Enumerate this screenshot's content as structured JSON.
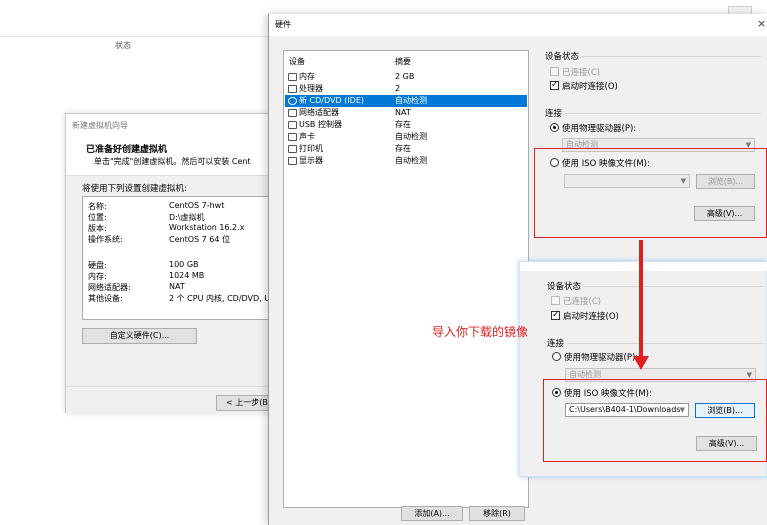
{
  "background": {
    "status_label": "状态"
  },
  "wizard": {
    "title": "新建虚拟机向导",
    "heading": "已准备好创建虚拟机",
    "subtext": "单击\"完成\"创建虚拟机。然后可以安装 Cent",
    "prompt": "将使用下列设置创建虚拟机:",
    "summary": [
      {
        "key": "名称:",
        "value": "CentOS 7-hwt"
      },
      {
        "key": "位置:",
        "value": "D:\\虚拟机"
      },
      {
        "key": "版本:",
        "value": "Workstation 16.2.x"
      },
      {
        "key": "操作系统:",
        "value": "CentOS 7 64 位"
      },
      {
        "key": "硬盘:",
        "value": "100 GB"
      },
      {
        "key": "内存:",
        "value": "1024 MB"
      },
      {
        "key": "网络适配器:",
        "value": "NAT"
      },
      {
        "key": "其他设备:",
        "value": "2 个 CPU 内核, CD/DVD, U"
      }
    ],
    "customize_button": "自定义硬件(C)...",
    "back_button": "< 上一步(B)"
  },
  "hardware": {
    "title": "硬件",
    "close_glyph": "×",
    "col_device": "设备",
    "col_summary": "摘要",
    "devices": [
      {
        "name": "内存",
        "summary": "2 GB",
        "icon": "memory-icon"
      },
      {
        "name": "处理器",
        "summary": "2",
        "icon": "cpu-icon"
      },
      {
        "name": "新 CD/DVD (IDE)",
        "summary": "自动检测",
        "icon": "cd-icon",
        "selected": true
      },
      {
        "name": "网络适配器",
        "summary": "NAT",
        "icon": "network-icon"
      },
      {
        "name": "USB 控制器",
        "summary": "存在",
        "icon": "usb-icon"
      },
      {
        "name": "声卡",
        "summary": "自动检测",
        "icon": "sound-icon"
      },
      {
        "name": "打印机",
        "summary": "存在",
        "icon": "printer-icon"
      },
      {
        "name": "显示器",
        "summary": "自动检测",
        "icon": "monitor-icon"
      }
    ],
    "add_button": "添加(A)...",
    "remove_button": "移除(R)",
    "device_status_label": "设备状态",
    "connected_label": "已连接(C)",
    "connect_at_power_on_label": "启动时连接(O)",
    "connection_label": "连接",
    "use_physical_label": "使用物理驱动器(P):",
    "physical_value": "自动检测",
    "use_iso_label": "使用 ISO 映像文件(M):",
    "iso_value": "",
    "browse_button": "浏览(B)...",
    "advanced_button": "高级(V)..."
  },
  "overlay": {
    "device_status_label": "设备状态",
    "connected_label": "已连接(C)",
    "connect_at_power_on_label": "启动时连接(O)",
    "connection_label": "连接",
    "use_physical_label": "使用物理驱动器(P):",
    "physical_value": "自动检测",
    "use_iso_label": "使用 ISO 映像文件(M):",
    "iso_value": "C:\\Users\\B404-1\\Downloads",
    "browse_button": "浏览(B)...",
    "advanced_button": "高级(V)..."
  },
  "annotation": "导入你下载的镜像",
  "colors": {
    "accent": "#0078d7",
    "annotation_red": "#e02020"
  }
}
